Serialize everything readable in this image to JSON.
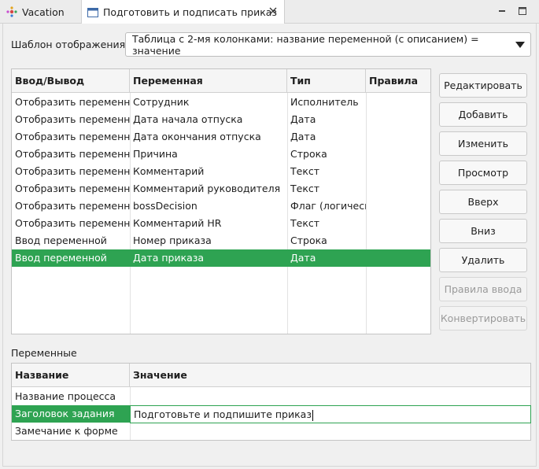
{
  "tabs": [
    {
      "label": "Vacation",
      "active": false
    },
    {
      "label": "Подготовить и подписать приказ",
      "active": true
    }
  ],
  "template": {
    "label": "Шаблон отображения",
    "value": "Таблица с 2-мя колонками: название переменной (с описанием) = значение"
  },
  "io_table": {
    "columns": [
      "Ввод/Вывод",
      "Переменная",
      "Тип",
      "Правила"
    ],
    "rows": [
      {
        "io": "Отобразить переменную",
        "var": "Сотрудник",
        "type": "Исполнитель",
        "rules": ""
      },
      {
        "io": "Отобразить переменную",
        "var": "Дата начала отпуска",
        "type": "Дата",
        "rules": ""
      },
      {
        "io": "Отобразить переменную",
        "var": "Дата окончания отпуска",
        "type": "Дата",
        "rules": ""
      },
      {
        "io": "Отобразить переменную",
        "var": "Причина",
        "type": "Строка",
        "rules": ""
      },
      {
        "io": "Отобразить переменную",
        "var": "Комментарий",
        "type": "Текст",
        "rules": ""
      },
      {
        "io": "Отобразить переменную",
        "var": "Комментарий руководителя",
        "type": "Текст",
        "rules": ""
      },
      {
        "io": "Отобразить переменную",
        "var": "bossDecision",
        "type": "Флаг (логический)",
        "rules": ""
      },
      {
        "io": "Отобразить переменную",
        "var": "Комментарий HR",
        "type": "Текст",
        "rules": ""
      },
      {
        "io": "Ввод переменной",
        "var": "Номер приказа",
        "type": "Строка",
        "rules": ""
      },
      {
        "io": "Ввод переменной",
        "var": "Дата приказа",
        "type": "Дата",
        "rules": "",
        "selected": true
      }
    ]
  },
  "buttons": [
    {
      "label": "Редактировать",
      "enabled": true
    },
    {
      "label": "Добавить",
      "enabled": true
    },
    {
      "label": "Изменить",
      "enabled": true
    },
    {
      "label": "Просмотр",
      "enabled": true
    },
    {
      "label": "Вверх",
      "enabled": true
    },
    {
      "label": "Вниз",
      "enabled": true
    },
    {
      "label": "Удалить",
      "enabled": true
    },
    {
      "label": "Правила ввода",
      "enabled": false
    },
    {
      "label": "Конвертировать",
      "enabled": false
    }
  ],
  "variables": {
    "label": "Переменные",
    "columns": [
      "Название",
      "Значение"
    ],
    "rows": [
      {
        "name": "Название процесса",
        "value": ""
      },
      {
        "name": "Заголовок задания",
        "value": "Подготовьте и подпишите приказ",
        "selected": true
      },
      {
        "name": "Замечание к форме",
        "value": ""
      }
    ]
  },
  "colors": {
    "selection": "#2ea352",
    "accent": "#0a64d8"
  },
  "icons": [
    "process-icon",
    "form-icon",
    "close-icon",
    "minimize-icon",
    "maximize-icon",
    "chevron-down-icon"
  ]
}
